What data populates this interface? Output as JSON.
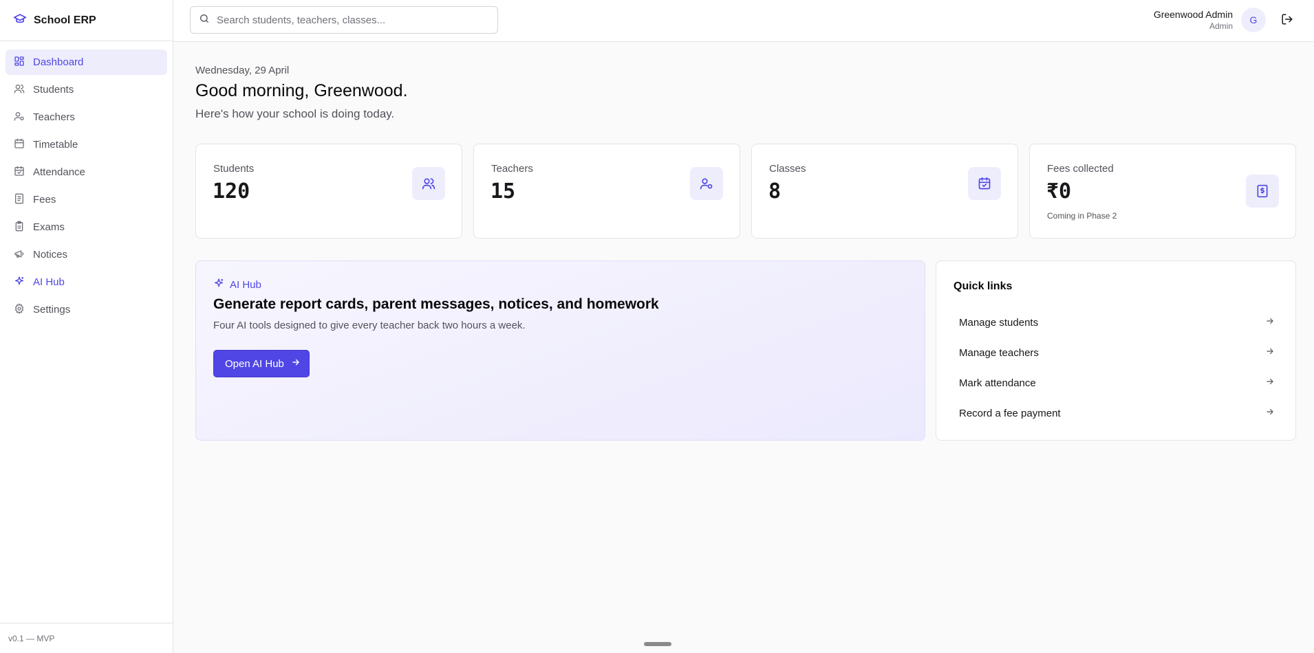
{
  "brand": {
    "name": "School ERP",
    "icon": "graduation-cap-icon"
  },
  "sidebar": {
    "items": [
      {
        "label": "Dashboard",
        "icon": "dashboard-icon",
        "active": true
      },
      {
        "label": "Students",
        "icon": "users-icon"
      },
      {
        "label": "Teachers",
        "icon": "user-cog-icon"
      },
      {
        "label": "Timetable",
        "icon": "calendar-icon"
      },
      {
        "label": "Attendance",
        "icon": "calendar-check-icon"
      },
      {
        "label": "Fees",
        "icon": "receipt-icon"
      },
      {
        "label": "Exams",
        "icon": "clipboard-icon"
      },
      {
        "label": "Notices",
        "icon": "megaphone-icon"
      },
      {
        "label": "AI Hub",
        "icon": "sparkles-icon"
      },
      {
        "label": "Settings",
        "icon": "gear-icon"
      }
    ],
    "footer": "v0.1 — MVP"
  },
  "topbar": {
    "search_placeholder": "Search students, teachers, classes...",
    "user_name": "Greenwood Admin",
    "user_role": "Admin",
    "avatar_initial": "G"
  },
  "main": {
    "date": "Wednesday, 29 April",
    "greeting": "Good morning, Greenwood.",
    "subtitle": "Here's how your school is doing today.",
    "stats": [
      {
        "label": "Students",
        "value": "120",
        "icon": "users-icon"
      },
      {
        "label": "Teachers",
        "value": "15",
        "icon": "user-cog-icon"
      },
      {
        "label": "Classes",
        "value": "8",
        "icon": "calendar-check-icon"
      },
      {
        "label": "Fees collected",
        "value": "₹0",
        "note": "Coming in Phase 2",
        "icon": "receipt-icon"
      }
    ],
    "ai_hub": {
      "tag": "AI Hub",
      "title": "Generate report cards, parent messages, notices, and homework",
      "description": "Four AI tools designed to give every teacher back two hours a week.",
      "button": "Open AI Hub"
    },
    "quick_links": {
      "title": "Quick links",
      "items": [
        "Manage students",
        "Manage teachers",
        "Mark attendance",
        "Record a fee payment"
      ]
    }
  },
  "colors": {
    "accent": "#4f46e5",
    "accent_soft": "#eeedfc",
    "border": "#e4e4e7",
    "background": "#fafafa"
  }
}
